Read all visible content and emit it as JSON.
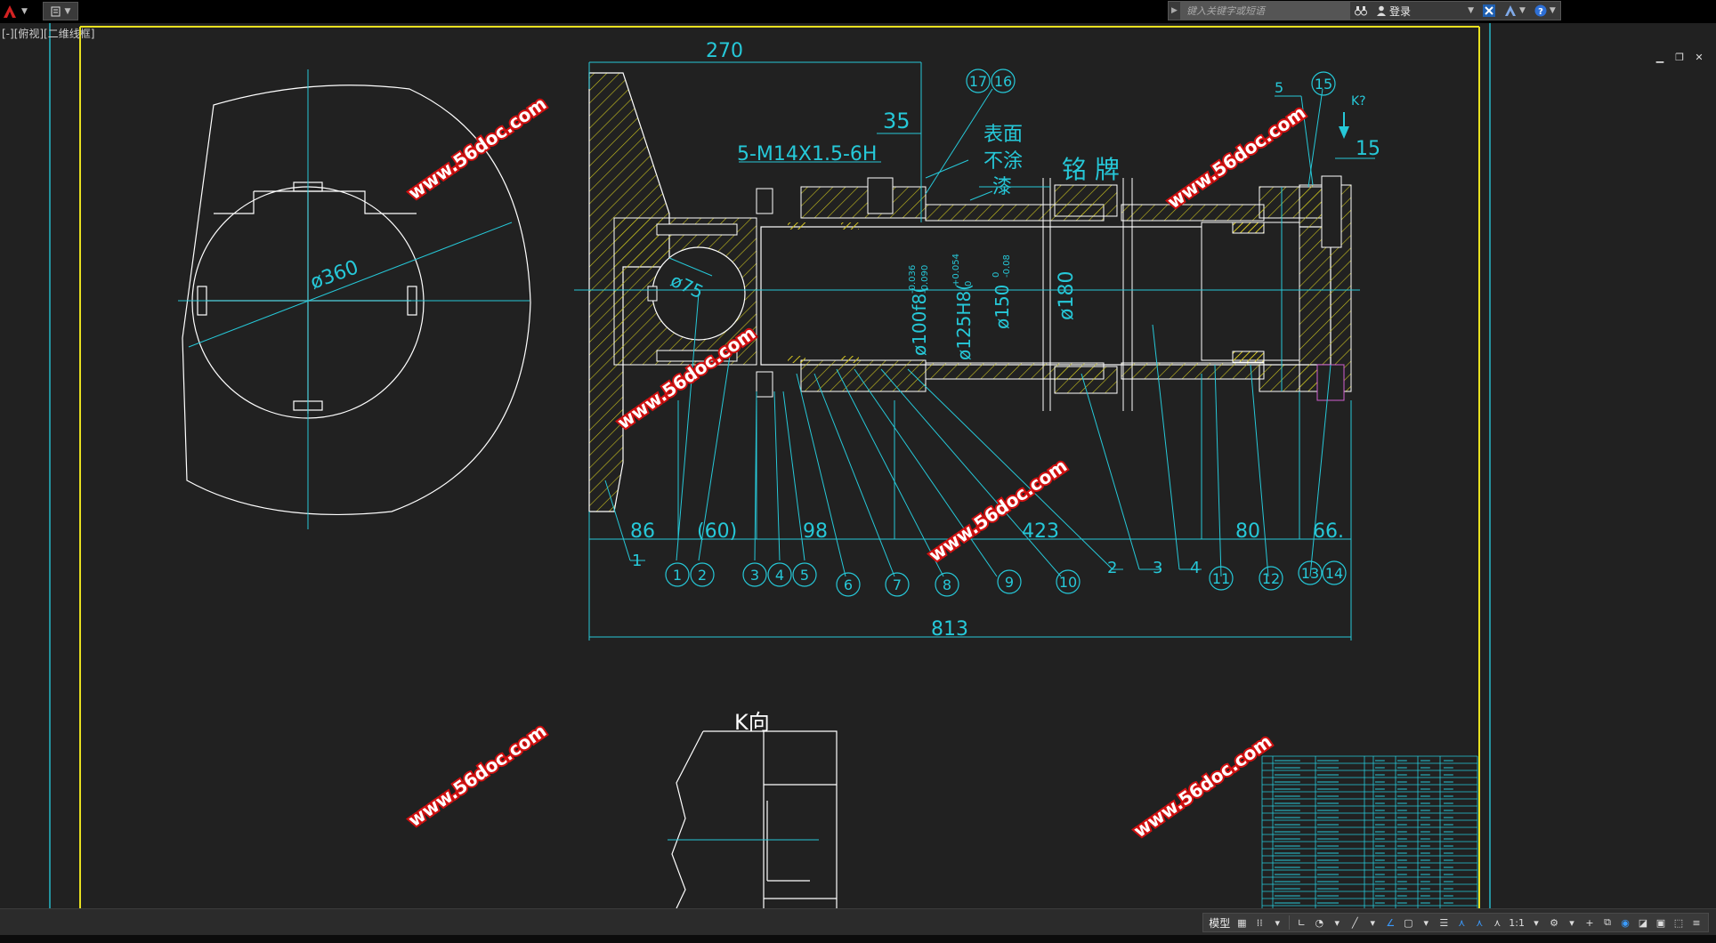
{
  "app": {
    "search_placeholder": "键入关键字或短语",
    "login_label": "登录",
    "viewport_label": "[-][俯视][二维线框]"
  },
  "drawing": {
    "dims": {
      "d270": "270",
      "d35": "35",
      "d15": "15",
      "d5": "5",
      "thread": "5-M14X1.5-6H",
      "kq": "K?",
      "phi360": "ø360",
      "phi75": "ø75",
      "phi100": "ø100f8(",
      "phi100_tol_up": "-0.036",
      "phi100_tol_dn": "-0.090",
      "phi125": "ø125H8(",
      "phi125_tol_up": "+0.054",
      "phi125_tol_dn": "0",
      "phi150": "ø150",
      "phi150_tol_up": "0",
      "phi150_tol_dn": "-0.08",
      "phi180": "ø180",
      "d86": "86",
      "d60": "(60)",
      "d98": "98",
      "d423": "423",
      "d80": "80",
      "d66": "66.",
      "d813": "813"
    },
    "notes": {
      "surface_1": "表面",
      "surface_2": "不涂",
      "surface_3": "漆",
      "nameplate": "铭 牌",
      "k_view": "K向"
    },
    "balloons_bottom": [
      "1",
      "2",
      "3",
      "4",
      "5",
      "6",
      "7",
      "8",
      "9",
      "10",
      "11",
      "12",
      "13",
      "14"
    ],
    "balloons_top": [
      "17",
      "16",
      "15"
    ],
    "leader_labels": {
      "l1": "1",
      "l2": "2",
      "l3": "3",
      "l4": "4"
    },
    "watermark": "www.56doc.com"
  },
  "status": {
    "model_label": "模型",
    "scale_label": "1:1"
  }
}
